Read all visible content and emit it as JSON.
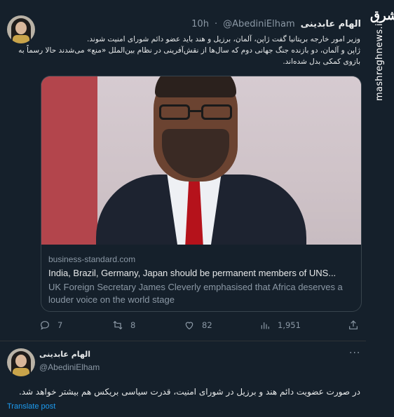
{
  "watermark": {
    "logo_text": "مشرق",
    "site_text": "mashreghnews.ir"
  },
  "tweet1": {
    "display_name": "الهام عابدینی",
    "handle": "@AbediniElham",
    "time": "10h",
    "body_line1": "وزیر امور خارجه بریتانیا گفت ژاپن، آلمان، برزیل و هند باید عضو دائم شورای امنیت شوند.",
    "body_line2": "ژاپن و آلمان، دو بازنده جنگ جهانی دوم که سال‌ها از نقش‌آفرینی در نظام بین‌الملل «منع» می‌شدند حالا رسماً به بازوی کمکی بدل شده‌اند.",
    "card": {
      "domain": "business-standard.com",
      "title": "India, Brazil, Germany, Japan should be permanent members of UNS...",
      "description": "UK Foreign Secretary James Cleverly emphasised that Africa deserves a louder voice on the world stage"
    },
    "actions": {
      "replies": "7",
      "retweets": "8",
      "likes": "82",
      "views": "1,951"
    },
    "icons": [
      "reply-icon",
      "retweet-icon",
      "like-icon",
      "views-icon",
      "share-icon"
    ]
  },
  "tweet2": {
    "display_name": "الهام عابدینی",
    "handle": "@AbediniElham",
    "more": "···",
    "body": "در صورت عضویت دائم هند و برزیل در شورای امنیت، قدرت سیاسی بریکس هم بیشتر خواهد شد.",
    "translate_label": "Translate post"
  },
  "colors": {
    "background": "#15202b",
    "text": "#e7e9ea",
    "muted": "#8b98a5",
    "link": "#1d9bf0",
    "border": "#38444d"
  }
}
